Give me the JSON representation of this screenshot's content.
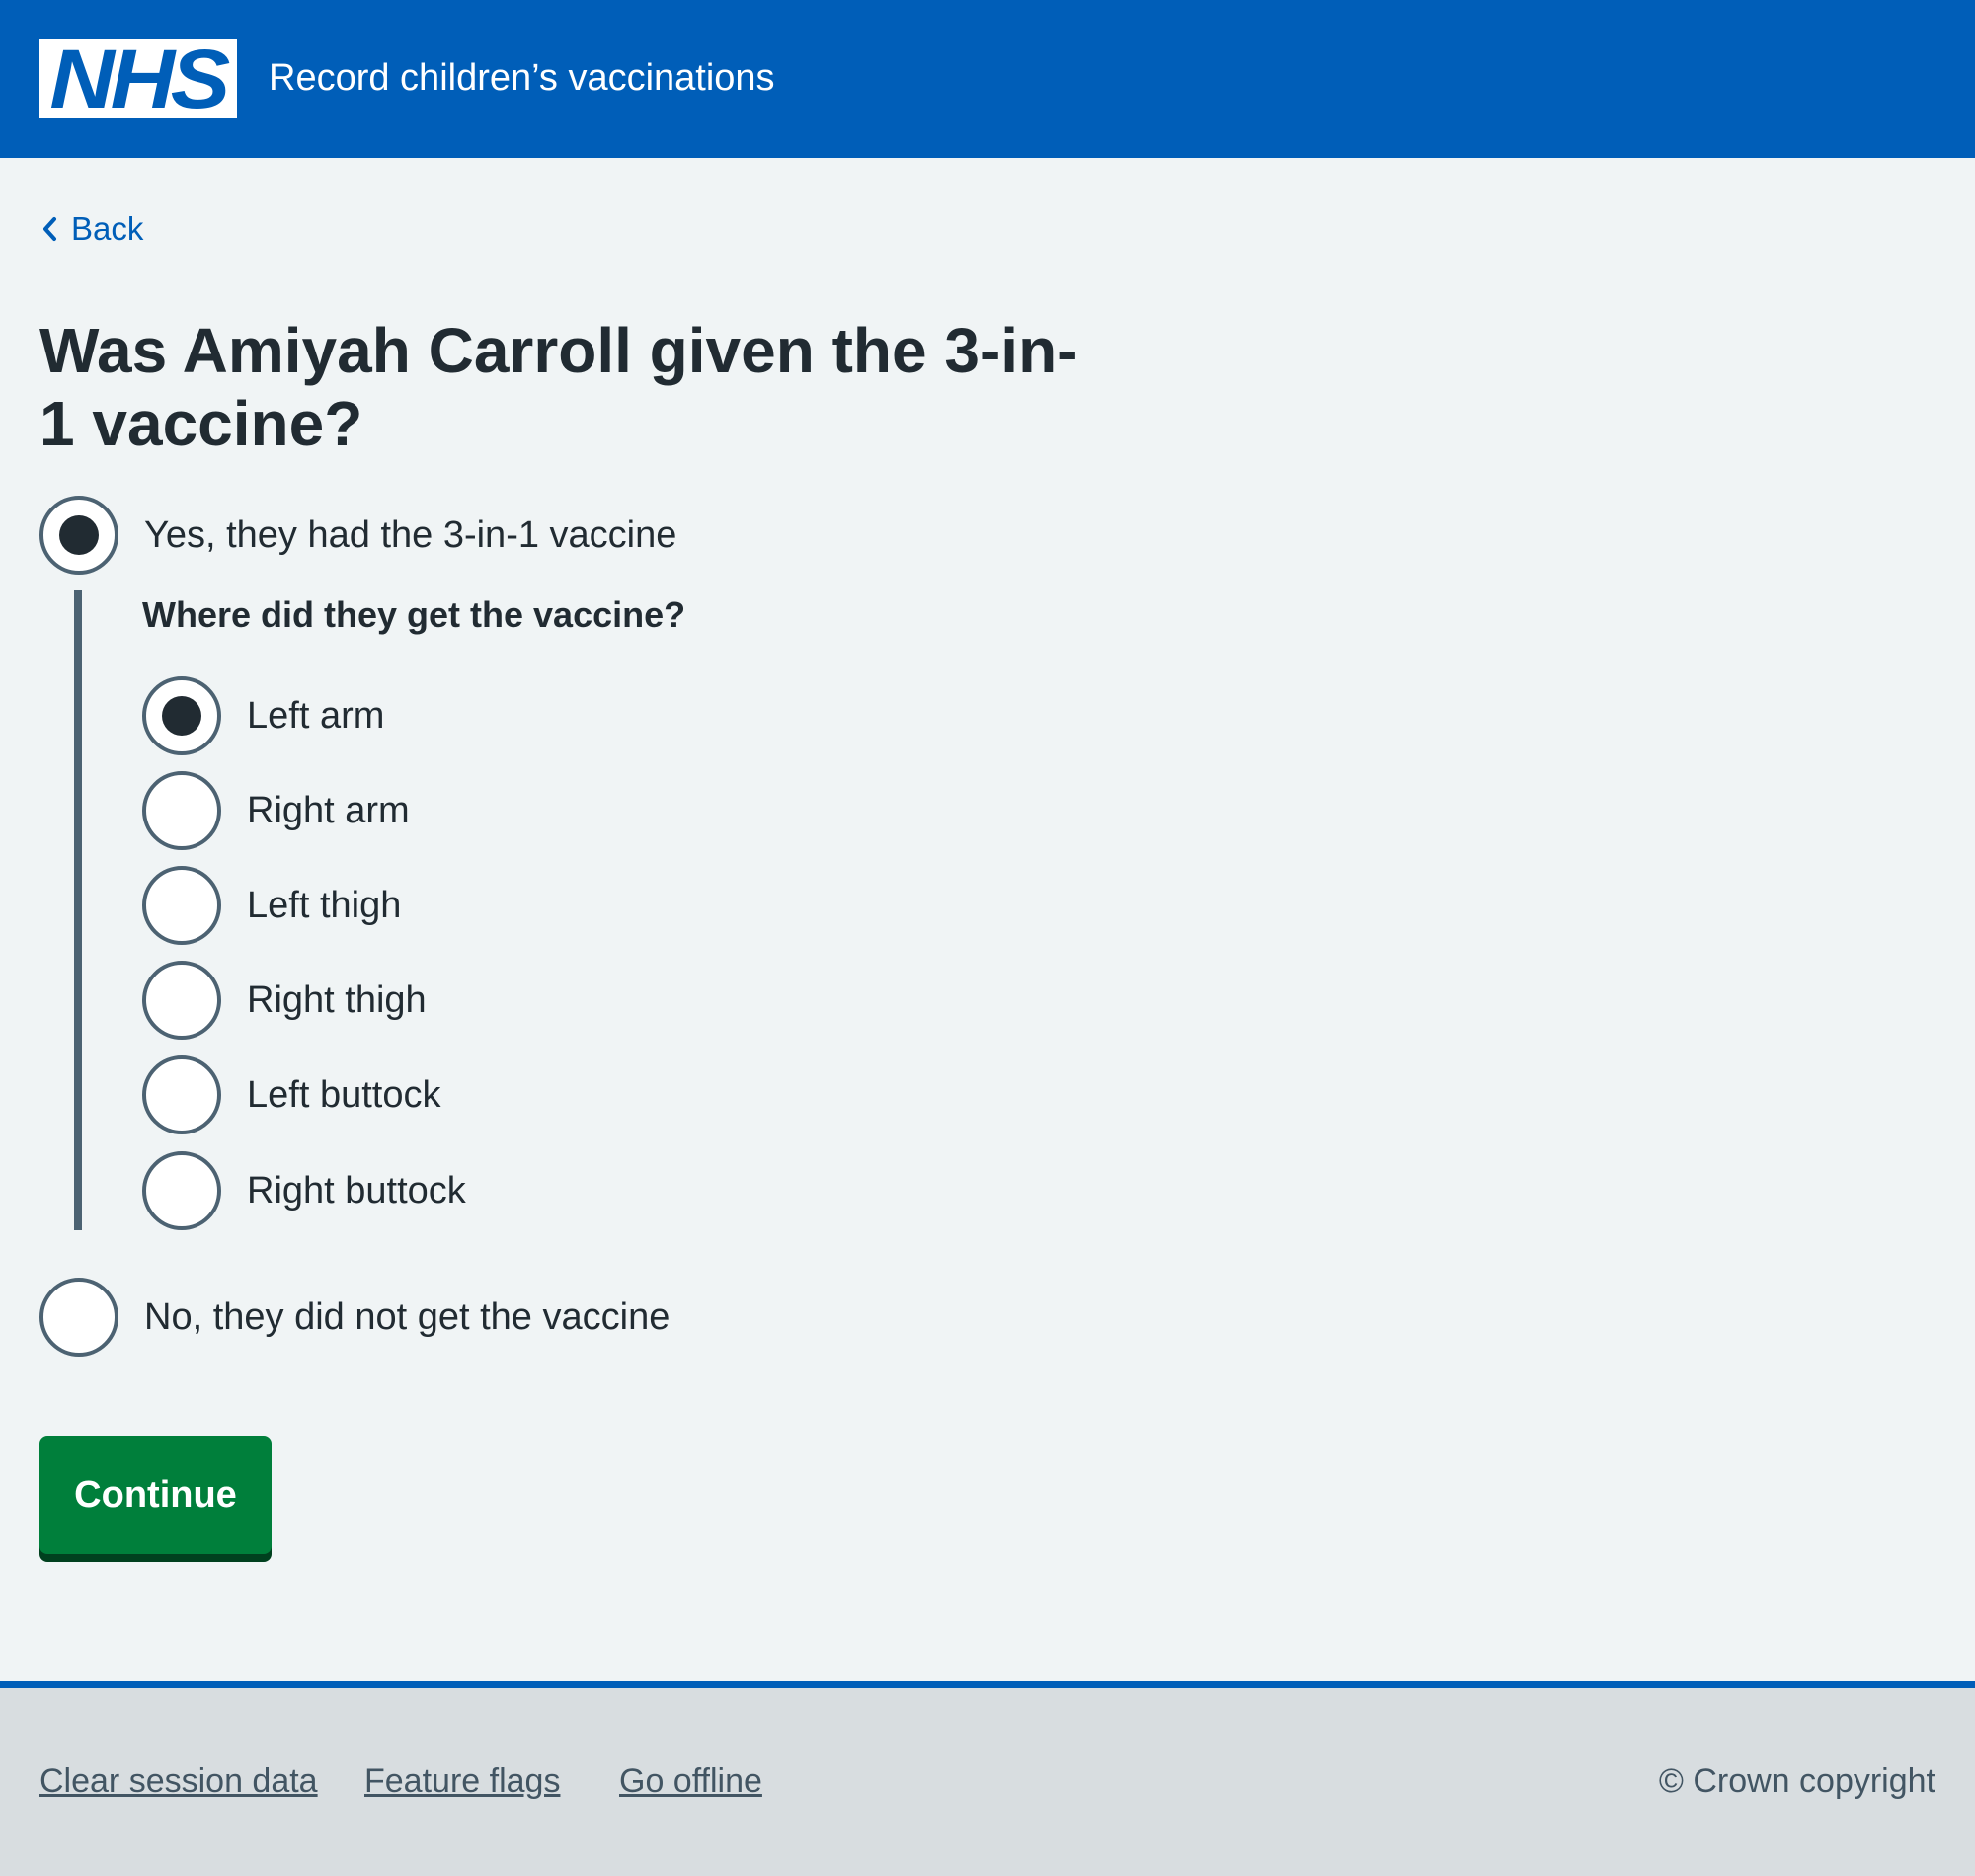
{
  "header": {
    "logo_text": "NHS",
    "service_name": "Record children’s vaccinations",
    "brand_color": "#005eb8"
  },
  "back_link": {
    "label": "Back",
    "icon": "chevron-left-icon"
  },
  "question": {
    "title": "Was Amiyah Carroll given the 3-in-1 vaccine?",
    "options": [
      {
        "label": "Yes, they had the 3-in-1 vaccine",
        "selected": true
      },
      {
        "label": "No, they did not get the vaccine",
        "selected": false
      }
    ]
  },
  "site_question": {
    "legend": "Where did they get the vaccine?",
    "options": [
      {
        "label": "Left arm",
        "selected": true
      },
      {
        "label": "Right arm",
        "selected": false
      },
      {
        "label": "Left thigh",
        "selected": false
      },
      {
        "label": "Right thigh",
        "selected": false
      },
      {
        "label": "Left buttock",
        "selected": false
      },
      {
        "label": "Right buttock",
        "selected": false
      }
    ]
  },
  "continue_button": {
    "label": "Continue",
    "color": "#007f3b"
  },
  "footer": {
    "links": [
      "Clear session data",
      "Feature flags",
      "Go offline"
    ],
    "copyright": "© Crown copyright"
  }
}
